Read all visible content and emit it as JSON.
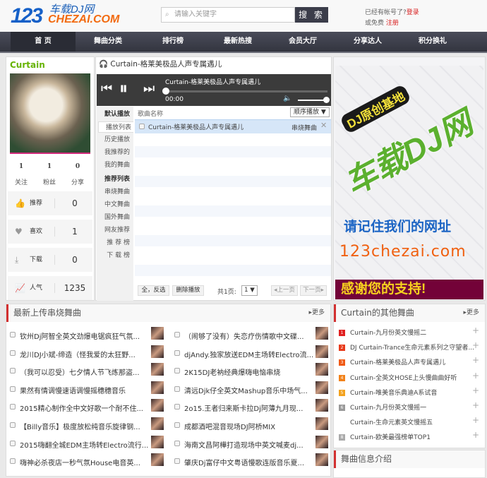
{
  "header": {
    "logo_num": "123",
    "logo_cn": "车载DJ网",
    "logo_domain": "CHEZAI.COM",
    "search_placeholder": "请输入关键字",
    "search_button": "搜 索",
    "login_prompt": "已经有帐号了?",
    "login": "登录",
    "register_prompt": "或免费",
    "register": "注册"
  },
  "nav": [
    "首 页",
    "舞曲分类",
    "排行榜",
    "最新热搜",
    "会员大厅",
    "分享达人",
    "积分换礼"
  ],
  "user": {
    "name": "Curtain",
    "stats": [
      {
        "value": "1",
        "label": "关注"
      },
      {
        "value": "1",
        "label": "粉丝"
      },
      {
        "value": "0",
        "label": "分享"
      }
    ],
    "rows": [
      {
        "icon": "thumbs-up-icon",
        "glyph": "👍",
        "label": "推荐",
        "value": "0"
      },
      {
        "icon": "heart-icon",
        "glyph": "♥",
        "label": "喜欢",
        "value": "1"
      },
      {
        "icon": "download-icon",
        "glyph": "⤓",
        "label": "下载",
        "value": "0"
      },
      {
        "icon": "chart-icon",
        "glyph": "📈",
        "label": "人气",
        "value": "1235"
      }
    ]
  },
  "player": {
    "title": "Curtain-格莱美极品人声专属遇儿",
    "track": "Curtain-格莱美极品人声专属遇儿",
    "time": "00:00",
    "progress": 0,
    "volume": 1.0,
    "side": [
      {
        "label": "默认播放",
        "h": true
      },
      {
        "label": "播放列表",
        "sel": true
      },
      {
        "label": "历史播放"
      },
      {
        "label": "我推荐的"
      },
      {
        "label": "我的舞曲"
      },
      {
        "label": "推荐列表",
        "h": true
      },
      {
        "label": "串烧舞曲"
      },
      {
        "label": "中文舞曲"
      },
      {
        "label": "国外舞曲"
      },
      {
        "label": "网友推荐"
      },
      {
        "label": "推 荐 榜"
      },
      {
        "label": "下 载 榜"
      }
    ],
    "col_header": "歌曲名称",
    "mode": "顺序播放 ▼",
    "row": {
      "name": "Curtain-格莱美极品人声专属遇儿",
      "genre": "串烧舞曲"
    },
    "footer": {
      "select": "全，反选",
      "delete": "删除播放",
      "pages": "共1页:",
      "page": "1 ▼",
      "prev": "◂上一页",
      "next": "下一页▸"
    }
  },
  "ad": {
    "line1": "DJ原创基地",
    "line2": "车载DJ网",
    "line3": "请记住我们的网址",
    "line4": "123chezai.com",
    "line5": "感谢您的支持!"
  },
  "latest": {
    "title": "最新上传串烧舞曲",
    "more": "更多",
    "left": [
      "钦州Dj阿智全英文劲爆电锯疯狂气氛...",
      "龙川DJ小斌-缔造（怪我爱的太狂野...",
      "（我可以忍受）七夕情人节飞炼那盗...",
      "果然有情调慢速语调慢摇穗穗音乐",
      "2015精心制作全中文好歌一个耐不住...",
      "【Billy音乐】极度放松纯音乐旋律钢...",
      "2015嗨翻全城EDM主场转Electro流行...",
      "嗨神必杀夜店一秒气氛House电音英..."
    ],
    "right": [
      "（闹够了没有）失恋疗伤情歌中文碟...",
      "djAndy.独家放送EDM主场转Electro流...",
      "2K15DJ老衲经典爆嗨电恼串烧",
      "清远Djk仔全英文Mashup音乐中场气...",
      "2o15.王者归来斯卡拉Dj阿薄九月现...",
      "成都酒吧混音现场DJ阿桥MIX",
      "海南文昌阿樺打造现场中英文喊麦dj...",
      "肇庆Dj富仔中文粤语慢歌连版音乐夏..."
    ]
  },
  "other": {
    "title": "Curtain的其他舞曲",
    "more": "更多",
    "items": [
      {
        "rank": "1",
        "color": "#e02020",
        "name": "Curtain-九月份英文慢摇二"
      },
      {
        "rank": "2",
        "color": "#e83a1a",
        "name": "DJ Curtain-Trance生命元素系列之守望者..."
      },
      {
        "rank": "3",
        "color": "#f05a14",
        "name": "Curtain-格莱美极品人声专属遇儿"
      },
      {
        "rank": "4",
        "color": "#f2821a",
        "name": "Curtain-全英文HOSE上头慢曲曲好听"
      },
      {
        "rank": "5",
        "color": "#f3a21e",
        "name": "Curtain-唯美音乐典迪A系试音"
      },
      {
        "rank": "6",
        "color": "#999999",
        "name": "Curtain-九月份英文慢摇一"
      },
      {
        "rank": "",
        "color": "",
        "name": "Curtain-生命元素英文慢摇五"
      },
      {
        "rank": "8",
        "color": "#aaaaaa",
        "name": "Curtain-欧美最强榜单TOP1"
      }
    ]
  },
  "info": {
    "title": "舞曲信息介绍"
  }
}
